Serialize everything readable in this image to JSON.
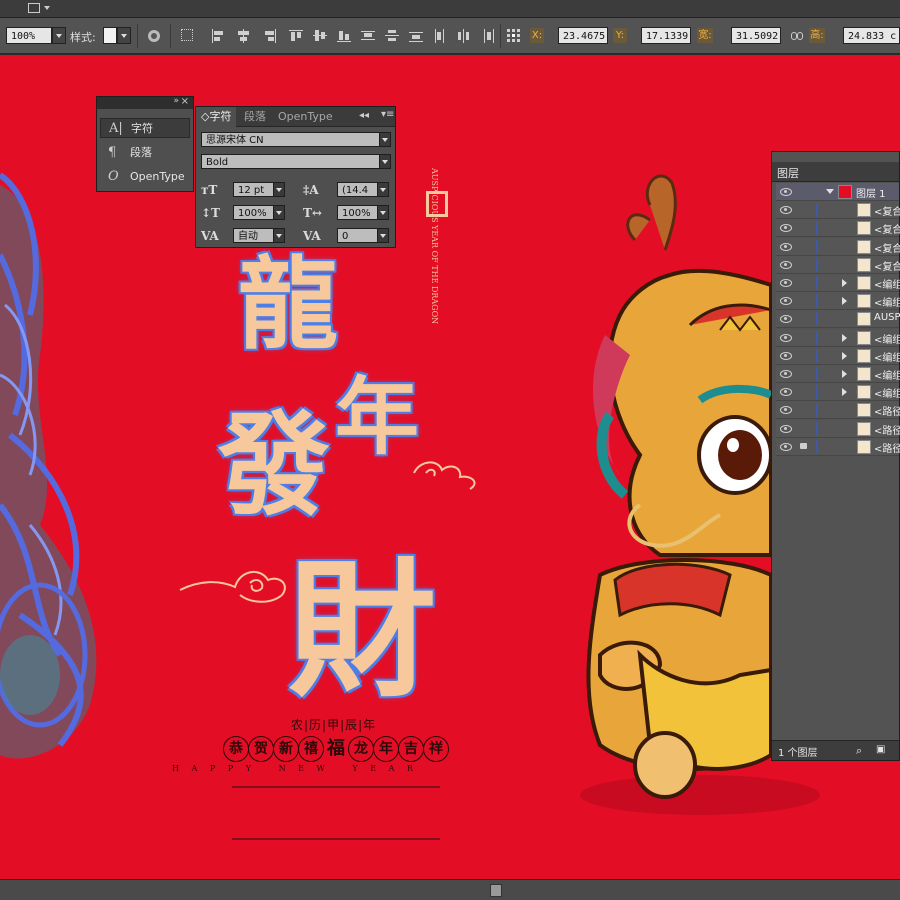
{
  "toolbar": {
    "zoom": "100%",
    "style_label": "样式:",
    "x_label": "X:",
    "x_value": "23.4675",
    "y_label": "Y:",
    "y_value": "17.1339",
    "w_label": "宽:",
    "w_value": "31.5092",
    "h_label": "高:",
    "h_value": "24.833 c"
  },
  "icon_panel": {
    "items": [
      {
        "glyph": "A|",
        "label": "字符",
        "icon": "character-icon"
      },
      {
        "glyph": "¶",
        "label": "段落",
        "icon": "paragraph-icon"
      },
      {
        "glyph": "O",
        "label": "OpenType",
        "icon": "opentype-icon"
      }
    ]
  },
  "char_panel": {
    "tabs": [
      "◇字符",
      "段落",
      "OpenType"
    ],
    "font_family": "思源宋体 CN",
    "font_style": "Bold",
    "font_size": "12 pt",
    "leading": "(14.4",
    "vscale": "100%",
    "hscale": "100%",
    "kerning": "自动",
    "tracking": "0"
  },
  "layers": {
    "title": "图层",
    "top_layer": "图层 1",
    "rows": [
      {
        "name": "<复合",
        "expand": false,
        "lock": false
      },
      {
        "name": "<复合",
        "expand": false,
        "lock": false
      },
      {
        "name": "<复合",
        "expand": false,
        "lock": false
      },
      {
        "name": "<复合",
        "expand": false,
        "lock": false
      },
      {
        "name": "<编组",
        "expand": true,
        "lock": false
      },
      {
        "name": "<编组",
        "expand": true,
        "lock": false
      },
      {
        "name": "AUSPI",
        "expand": false,
        "lock": false
      },
      {
        "name": "<编组",
        "expand": true,
        "lock": false
      },
      {
        "name": "<编组",
        "expand": true,
        "lock": false
      },
      {
        "name": "<编组",
        "expand": true,
        "lock": false
      },
      {
        "name": "<编组",
        "expand": true,
        "lock": false
      },
      {
        "name": "<路径",
        "expand": false,
        "lock": false
      },
      {
        "name": "<路径",
        "expand": false,
        "lock": false
      },
      {
        "name": "<路径",
        "expand": false,
        "lock": true
      }
    ],
    "footer": "1 个图层"
  },
  "poster": {
    "title_1": "龍",
    "title_2": "年",
    "title_3": "發",
    "title_4": "財",
    "vertical_en": "AUSPICIOUS YEAR OF THE DRAGON",
    "lunar": "农|历|甲|辰|年",
    "blessing_left": [
      "恭",
      "贺",
      "新",
      "禧"
    ],
    "blessing_mid": "福",
    "blessing_right": [
      "龙",
      "年",
      "吉",
      "祥"
    ],
    "happy": "H A P P Y   N E W   Y E A R"
  }
}
